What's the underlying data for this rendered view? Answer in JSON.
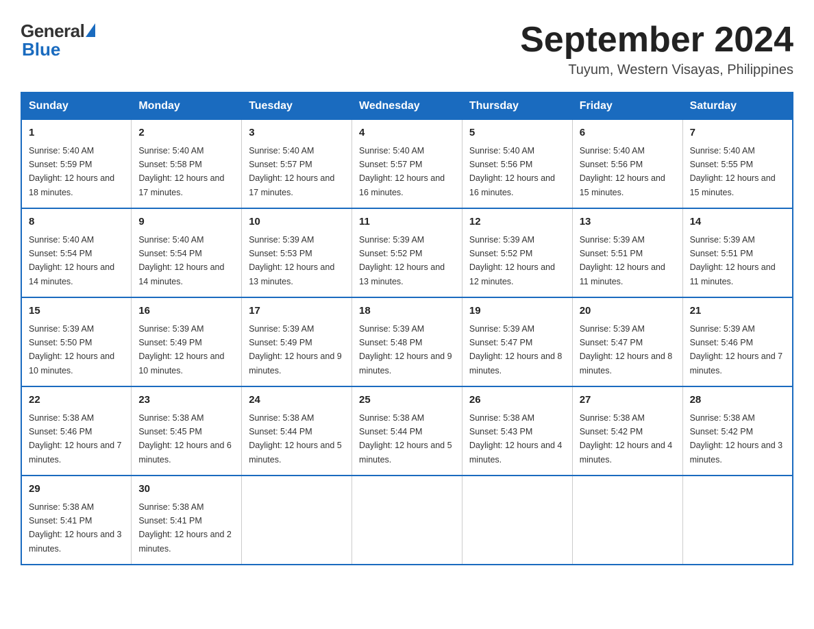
{
  "logo": {
    "general": "General",
    "blue": "Blue"
  },
  "title": "September 2024",
  "subtitle": "Tuyum, Western Visayas, Philippines",
  "headers": [
    "Sunday",
    "Monday",
    "Tuesday",
    "Wednesday",
    "Thursday",
    "Friday",
    "Saturday"
  ],
  "weeks": [
    [
      {
        "day": "1",
        "sunrise": "5:40 AM",
        "sunset": "5:59 PM",
        "daylight": "12 hours and 18 minutes."
      },
      {
        "day": "2",
        "sunrise": "5:40 AM",
        "sunset": "5:58 PM",
        "daylight": "12 hours and 17 minutes."
      },
      {
        "day": "3",
        "sunrise": "5:40 AM",
        "sunset": "5:57 PM",
        "daylight": "12 hours and 17 minutes."
      },
      {
        "day": "4",
        "sunrise": "5:40 AM",
        "sunset": "5:57 PM",
        "daylight": "12 hours and 16 minutes."
      },
      {
        "day": "5",
        "sunrise": "5:40 AM",
        "sunset": "5:56 PM",
        "daylight": "12 hours and 16 minutes."
      },
      {
        "day": "6",
        "sunrise": "5:40 AM",
        "sunset": "5:56 PM",
        "daylight": "12 hours and 15 minutes."
      },
      {
        "day": "7",
        "sunrise": "5:40 AM",
        "sunset": "5:55 PM",
        "daylight": "12 hours and 15 minutes."
      }
    ],
    [
      {
        "day": "8",
        "sunrise": "5:40 AM",
        "sunset": "5:54 PM",
        "daylight": "12 hours and 14 minutes."
      },
      {
        "day": "9",
        "sunrise": "5:40 AM",
        "sunset": "5:54 PM",
        "daylight": "12 hours and 14 minutes."
      },
      {
        "day": "10",
        "sunrise": "5:39 AM",
        "sunset": "5:53 PM",
        "daylight": "12 hours and 13 minutes."
      },
      {
        "day": "11",
        "sunrise": "5:39 AM",
        "sunset": "5:52 PM",
        "daylight": "12 hours and 13 minutes."
      },
      {
        "day": "12",
        "sunrise": "5:39 AM",
        "sunset": "5:52 PM",
        "daylight": "12 hours and 12 minutes."
      },
      {
        "day": "13",
        "sunrise": "5:39 AM",
        "sunset": "5:51 PM",
        "daylight": "12 hours and 11 minutes."
      },
      {
        "day": "14",
        "sunrise": "5:39 AM",
        "sunset": "5:51 PM",
        "daylight": "12 hours and 11 minutes."
      }
    ],
    [
      {
        "day": "15",
        "sunrise": "5:39 AM",
        "sunset": "5:50 PM",
        "daylight": "12 hours and 10 minutes."
      },
      {
        "day": "16",
        "sunrise": "5:39 AM",
        "sunset": "5:49 PM",
        "daylight": "12 hours and 10 minutes."
      },
      {
        "day": "17",
        "sunrise": "5:39 AM",
        "sunset": "5:49 PM",
        "daylight": "12 hours and 9 minutes."
      },
      {
        "day": "18",
        "sunrise": "5:39 AM",
        "sunset": "5:48 PM",
        "daylight": "12 hours and 9 minutes."
      },
      {
        "day": "19",
        "sunrise": "5:39 AM",
        "sunset": "5:47 PM",
        "daylight": "12 hours and 8 minutes."
      },
      {
        "day": "20",
        "sunrise": "5:39 AM",
        "sunset": "5:47 PM",
        "daylight": "12 hours and 8 minutes."
      },
      {
        "day": "21",
        "sunrise": "5:39 AM",
        "sunset": "5:46 PM",
        "daylight": "12 hours and 7 minutes."
      }
    ],
    [
      {
        "day": "22",
        "sunrise": "5:38 AM",
        "sunset": "5:46 PM",
        "daylight": "12 hours and 7 minutes."
      },
      {
        "day": "23",
        "sunrise": "5:38 AM",
        "sunset": "5:45 PM",
        "daylight": "12 hours and 6 minutes."
      },
      {
        "day": "24",
        "sunrise": "5:38 AM",
        "sunset": "5:44 PM",
        "daylight": "12 hours and 5 minutes."
      },
      {
        "day": "25",
        "sunrise": "5:38 AM",
        "sunset": "5:44 PM",
        "daylight": "12 hours and 5 minutes."
      },
      {
        "day": "26",
        "sunrise": "5:38 AM",
        "sunset": "5:43 PM",
        "daylight": "12 hours and 4 minutes."
      },
      {
        "day": "27",
        "sunrise": "5:38 AM",
        "sunset": "5:42 PM",
        "daylight": "12 hours and 4 minutes."
      },
      {
        "day": "28",
        "sunrise": "5:38 AM",
        "sunset": "5:42 PM",
        "daylight": "12 hours and 3 minutes."
      }
    ],
    [
      {
        "day": "29",
        "sunrise": "5:38 AM",
        "sunset": "5:41 PM",
        "daylight": "12 hours and 3 minutes."
      },
      {
        "day": "30",
        "sunrise": "5:38 AM",
        "sunset": "5:41 PM",
        "daylight": "12 hours and 2 minutes."
      },
      null,
      null,
      null,
      null,
      null
    ]
  ]
}
